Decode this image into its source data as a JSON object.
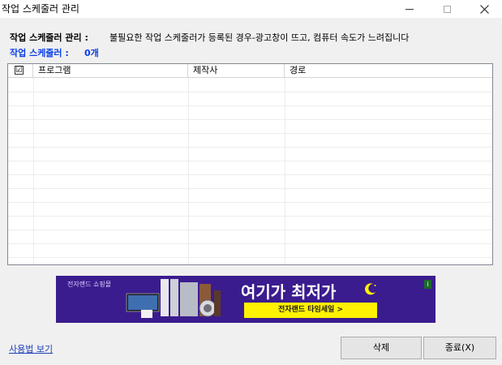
{
  "window": {
    "title": "작업 스케줄러 관리"
  },
  "info": {
    "label": "작업 스케줄러 관리 :",
    "description": "불필요한 작업 스케줄러가 등록된 경우-광고창이 뜨고, 컴퓨터 속도가 느려집니다"
  },
  "count": {
    "label": "작업 스케줄러 :",
    "value": "0개"
  },
  "table": {
    "headers": {
      "check": "☑",
      "program": "프로그램",
      "maker": "제작사",
      "path": "경로"
    },
    "rows": []
  },
  "banner": {
    "brand": "전자랜드 쇼핑몰",
    "headline": "여기가 최저가",
    "cta": "전자랜드 타임세일 >",
    "info_badge": "i",
    "colors": {
      "background": "#3b1c8e",
      "cta": "#fff200"
    }
  },
  "footer": {
    "help_link": "사용법 보기",
    "delete_button": "삭제",
    "close_button": "종료(X)"
  }
}
